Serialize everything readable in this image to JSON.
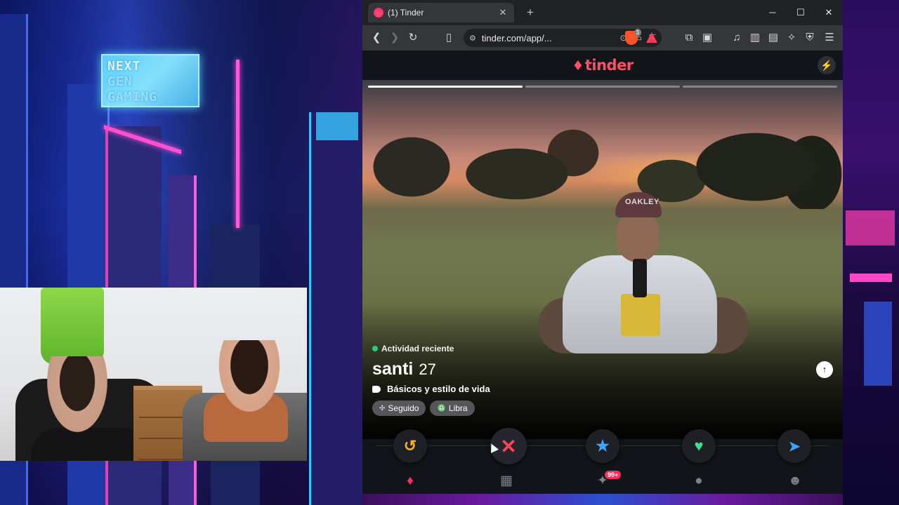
{
  "stream_overlay": {
    "logo_lines": [
      "NEXT",
      "GEN",
      "GAMING"
    ]
  },
  "browser": {
    "tab": {
      "title": "(1) Tinder"
    },
    "url": "tinder.com/app/...",
    "shield_count": "3"
  },
  "tinder": {
    "logo": "tinder",
    "profile": {
      "activity": "Actividad reciente",
      "name": "santi",
      "age": "27",
      "lifestyle_label": "Básicos y estilo de vida",
      "chips": [
        {
          "icon": "paw-icon",
          "label": "Seguido"
        },
        {
          "icon": "zodiac-icon",
          "label": "Libra"
        }
      ],
      "cap_text": "OAKLEY"
    },
    "photo_progress": {
      "total": 3,
      "current": 1
    },
    "nav": {
      "badge": "99+"
    }
  },
  "colors": {
    "brand": "#fd5068",
    "nope": "#ff4458",
    "rewind": "#f5b11e",
    "super_like": "#3ca4ff",
    "like": "#3fe088",
    "online": "#21d07c"
  }
}
